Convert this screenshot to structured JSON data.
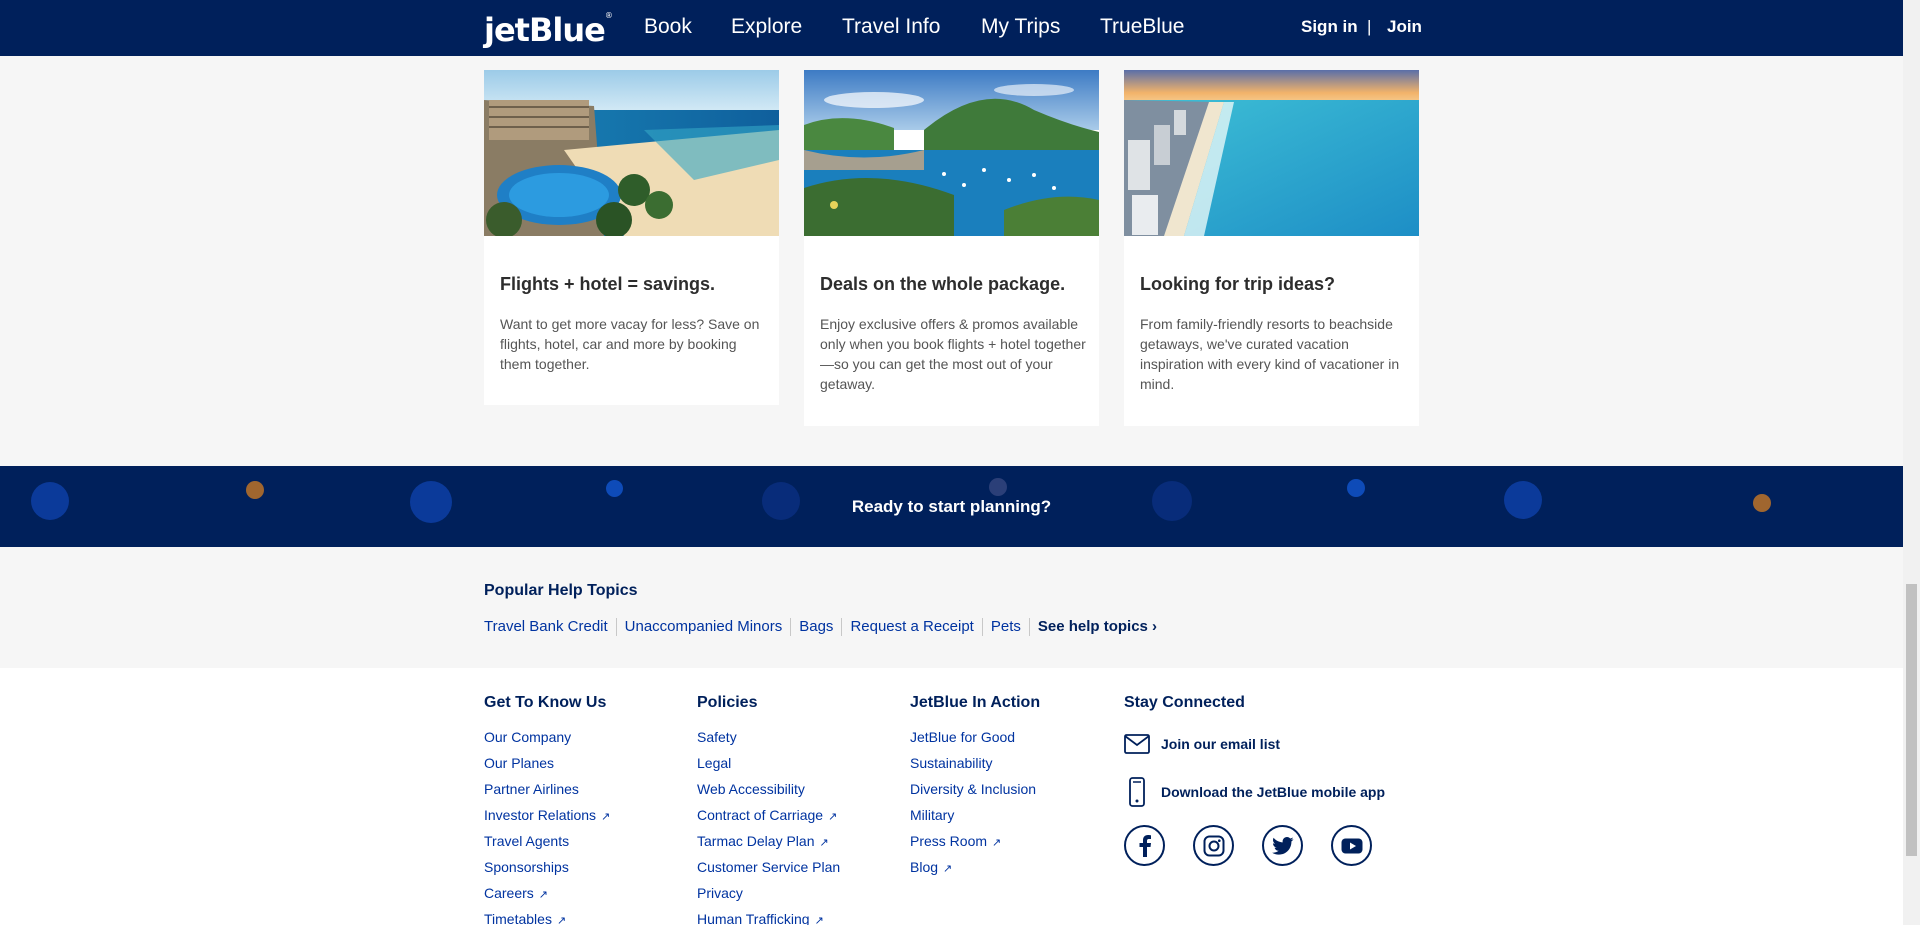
{
  "header": {
    "logo": "jetBlue",
    "nav": [
      "Book",
      "Explore",
      "Travel Info",
      "My Trips",
      "TrueBlue"
    ],
    "sign_in": "Sign in",
    "separator": "|",
    "join": "Join"
  },
  "cards": [
    {
      "title": "Flights + hotel = savings.",
      "text": "Want to get more vacay for less? Save on flights, hotel, car and more by booking them together."
    },
    {
      "title": "Deals on the whole package.",
      "text": "Enjoy exclusive offers & promos available only when you book flights + hotel together—so you can get the most out of your getaway."
    },
    {
      "title": "Looking for trip ideas?",
      "text": "From family-friendly resorts to beachside getaways, we've curated vacation inspiration with every kind of vacationer in mind."
    }
  ],
  "banner": {
    "text": "Ready to start planning?"
  },
  "help": {
    "title": "Popular Help Topics",
    "links": [
      "Travel Bank Credit",
      "Unaccompanied Minors",
      "Bags",
      "Request a Receipt",
      "Pets"
    ],
    "more": "See help topics ›"
  },
  "footer": {
    "columns": [
      {
        "title": "Get To Know Us",
        "links": [
          "Our Company",
          "Our Planes",
          "Partner Airlines",
          "Investor Relations",
          "Travel Agents",
          "Sponsorships",
          "Careers",
          "Timetables"
        ]
      },
      {
        "title": "Policies",
        "links": [
          "Safety",
          "Legal",
          "Web Accessibility",
          "Contract of Carriage",
          "Tarmac Delay Plan",
          "Customer Service Plan",
          "Privacy",
          "Human Trafficking"
        ]
      },
      {
        "title": "JetBlue In Action",
        "links": [
          "JetBlue for Good",
          "Sustainability",
          "Diversity & Inclusion",
          "Military",
          "Press Room",
          "Blog"
        ]
      }
    ],
    "connect": {
      "title": "Stay Connected",
      "email": "Join our email list",
      "app": "Download the JetBlue mobile app",
      "social": [
        "facebook-icon",
        "instagram-icon",
        "twitter-icon",
        "youtube-icon"
      ]
    },
    "external_marker": "↗"
  },
  "colors": {
    "navy": "#00205b",
    "link": "#0033a0",
    "background": "#f6f6f6"
  }
}
